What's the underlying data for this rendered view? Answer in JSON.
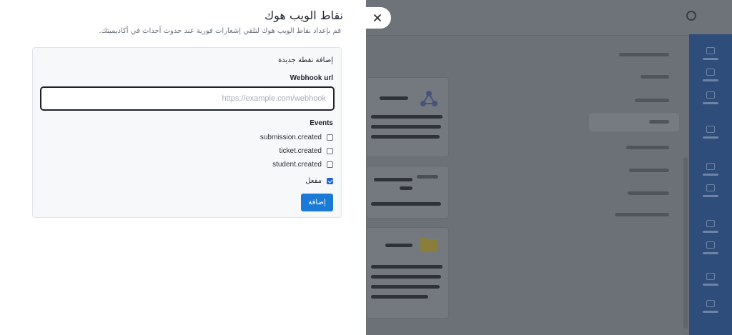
{
  "drawer": {
    "title": "نقاط الويب هوك",
    "description": "قم بإعداد نقاط الويب هوك لتلقي إشعارات فورية عند حدوث أحداث في أكاديميتك.",
    "form": {
      "section_title": "إضافة نقطة جديدة",
      "url_label": "Webhook url",
      "url_value": "",
      "url_placeholder": "https://example.com/webhook",
      "events_label": "Events",
      "events": [
        {
          "label": "submission.created",
          "checked": false
        },
        {
          "label": "ticket.created",
          "checked": false
        },
        {
          "label": "student.created",
          "checked": false
        }
      ],
      "enabled_label": "مفعل",
      "enabled_checked": true,
      "add_button_label": "إضافة"
    }
  },
  "close_icon": "close-icon",
  "colors": {
    "overlay": "#6b6f75",
    "primary_button": "#1b7ad6",
    "checkbox_checked": "#1f64d8",
    "sidebar_rail": "#2f4d7a"
  }
}
